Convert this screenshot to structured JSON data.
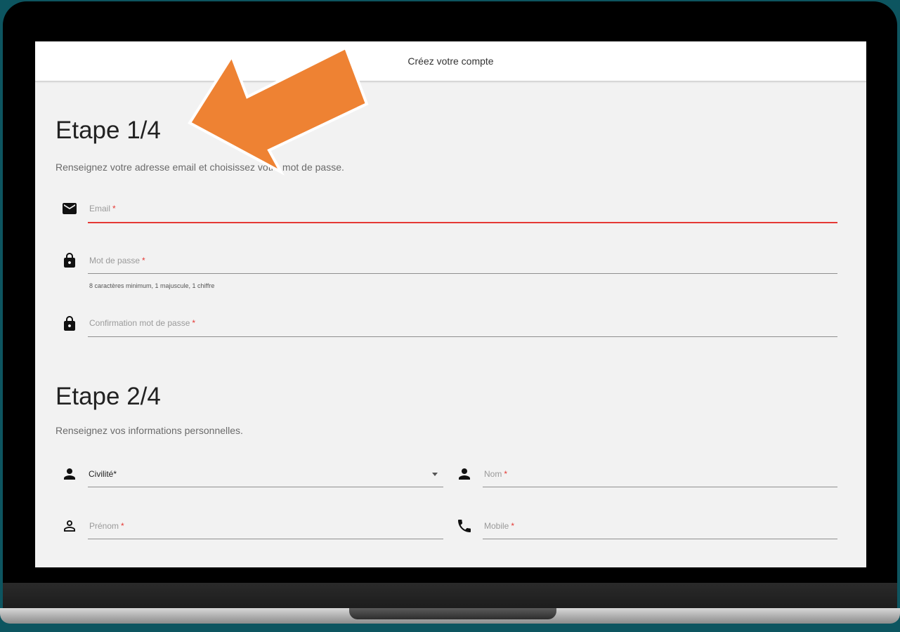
{
  "header": {
    "title": "Créez votre compte"
  },
  "step1": {
    "title": "Etape 1/4",
    "subtitle": "Renseignez votre adresse email et choisissez votre mot de passe.",
    "email_label": "Email",
    "password_label": "Mot de passe",
    "password_hint": "8 caractères minimum, 1 majuscule, 1 chiffre",
    "confirm_label": "Confirmation mot de passe"
  },
  "step2": {
    "title": "Etape 2/4",
    "subtitle": "Renseignez vos informations personnelles.",
    "civility_value": "Civilité*",
    "lastname_label": "Nom",
    "firstname_label": "Prénom",
    "mobile_label": "Mobile"
  },
  "required_mark": "*",
  "icons": {
    "email": "mail-icon",
    "password": "lock-icon",
    "confirm": "lock-icon",
    "civility": "person-icon",
    "lastname": "person-icon",
    "firstname": "person-outline-icon",
    "mobile": "phone-icon"
  },
  "colors": {
    "error": "#e53935",
    "arrow": "#ee8233",
    "background": "#0d5560"
  }
}
